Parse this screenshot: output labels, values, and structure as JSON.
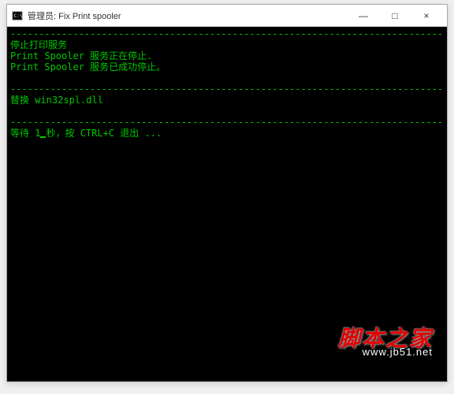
{
  "window": {
    "title": "管理员: Fix Print spooler"
  },
  "controls": {
    "minimize": "—",
    "maximize": "□",
    "close": "×"
  },
  "terminal": {
    "separator": "--------------------------------------------------------------------------------",
    "lines": [
      "停止打印服务",
      "Print Spooler 服务正在停止.",
      "Print Spooler 服务已成功停止。"
    ],
    "line_replace": "替换 win32spl.dll",
    "line_wait_prefix": "等待 1",
    "line_wait_suffix": "秒，按 CTRL+C 退出 ..."
  },
  "watermark": {
    "text": "脚本之家",
    "url": "www.jb51.net"
  }
}
